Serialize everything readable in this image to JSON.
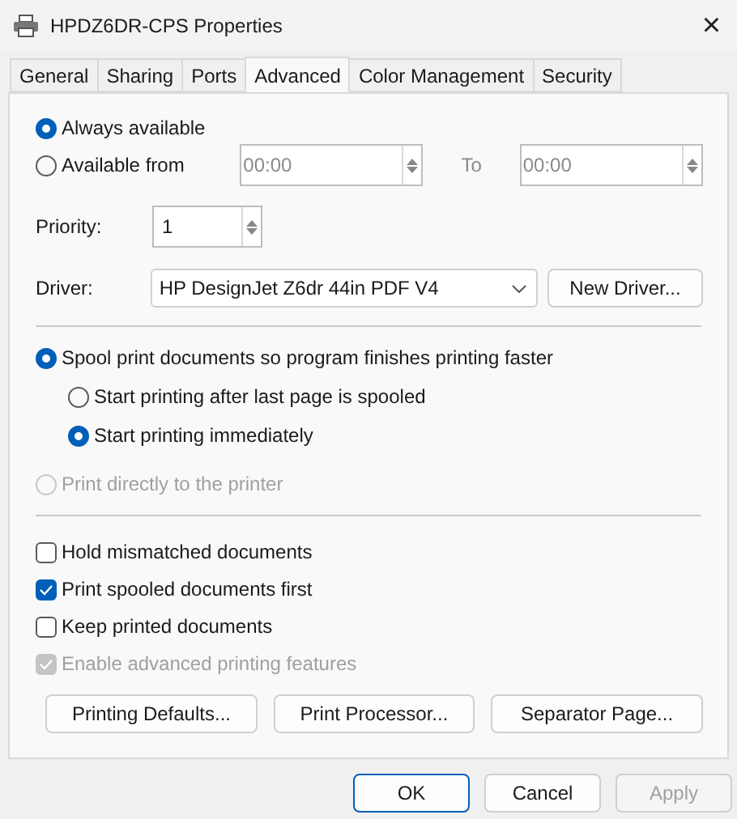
{
  "window": {
    "title": "HPDZ6DR-CPS Properties",
    "close": "×"
  },
  "tabs": [
    {
      "label": "General",
      "selected": false
    },
    {
      "label": "Sharing",
      "selected": false
    },
    {
      "label": "Ports",
      "selected": false
    },
    {
      "label": "Advanced",
      "selected": true
    },
    {
      "label": "Color Management",
      "selected": false
    },
    {
      "label": "Security",
      "selected": false
    }
  ],
  "availability": {
    "options": [
      {
        "label": "Always available",
        "selected": true
      },
      {
        "label": "Available from",
        "selected": false
      }
    ],
    "from_time": "00:00",
    "to_label": "To",
    "to_time": "00:00"
  },
  "priority": {
    "label": "Priority:",
    "value": "1"
  },
  "driver": {
    "label": "Driver:",
    "value": "HP DesignJet Z6dr 44in PDF V4",
    "button": "New Driver..."
  },
  "spooling": [
    {
      "label": "Spool print documents so program finishes printing faster",
      "selected": true,
      "disabled": false,
      "children": [
        {
          "label": "Start printing after last page is spooled",
          "selected": false,
          "disabled": false
        },
        {
          "label": "Start printing immediately",
          "selected": true,
          "disabled": false
        }
      ]
    },
    {
      "label": "Print directly to the printer",
      "selected": false,
      "disabled": true
    }
  ],
  "options": [
    {
      "label": "Hold mismatched documents",
      "checked": false,
      "disabled": false
    },
    {
      "label": "Print spooled documents first",
      "checked": true,
      "disabled": false
    },
    {
      "label": "Keep printed documents",
      "checked": false,
      "disabled": false
    },
    {
      "label": "Enable advanced printing features",
      "checked": true,
      "disabled": true
    }
  ],
  "action_buttons": [
    "Printing Defaults...",
    "Print Processor...",
    "Separator Page..."
  ],
  "dialog_buttons": [
    {
      "label": "OK",
      "default": true,
      "disabled": false
    },
    {
      "label": "Cancel",
      "default": false,
      "disabled": false
    },
    {
      "label": "Apply",
      "default": false,
      "disabled": true
    }
  ]
}
